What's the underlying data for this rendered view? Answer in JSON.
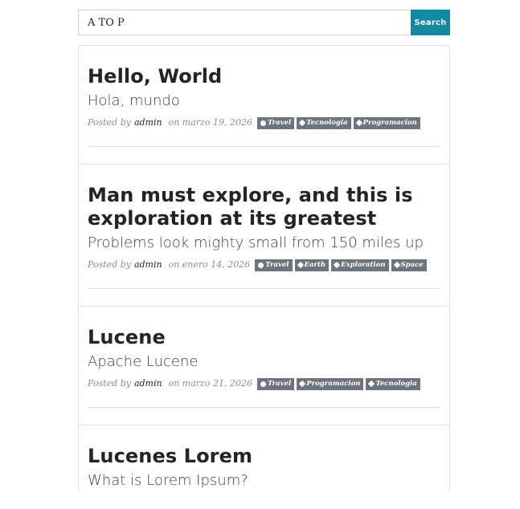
{
  "search": {
    "value": "A TO P",
    "button_label": "Search"
  },
  "posts": [
    {
      "title": "Hello, World",
      "subtitle": "Hola, mundo",
      "posted_by_label": "Posted by",
      "author": "admin",
      "date": "on marzo 19, 2026",
      "tags": [
        "Travel",
        "Tecnologia",
        "Programacion"
      ]
    },
    {
      "title": "Man must explore, and this is exploration at its greatest",
      "subtitle": "Problems look mighty small from 150 miles up",
      "posted_by_label": "Posted by",
      "author": "admin",
      "date": "on enero 14, 2026",
      "tags": [
        "Travel",
        "Earth",
        "Exploration",
        "Space"
      ]
    },
    {
      "title": "Lucene",
      "subtitle": "Apache Lucene",
      "posted_by_label": "Posted by",
      "author": "admin",
      "date": "on marzo 21, 2026",
      "tags": [
        "Travel",
        "Programacion",
        "Tecnologia"
      ]
    },
    {
      "title": "Lucenes Lorem",
      "subtitle": "What is Lorem Ipsum?",
      "posted_by_label": "",
      "author": "",
      "date": "",
      "tags": []
    }
  ],
  "colors": {
    "search_button": "#0f8aa3",
    "tag_background": "#6c757d"
  }
}
